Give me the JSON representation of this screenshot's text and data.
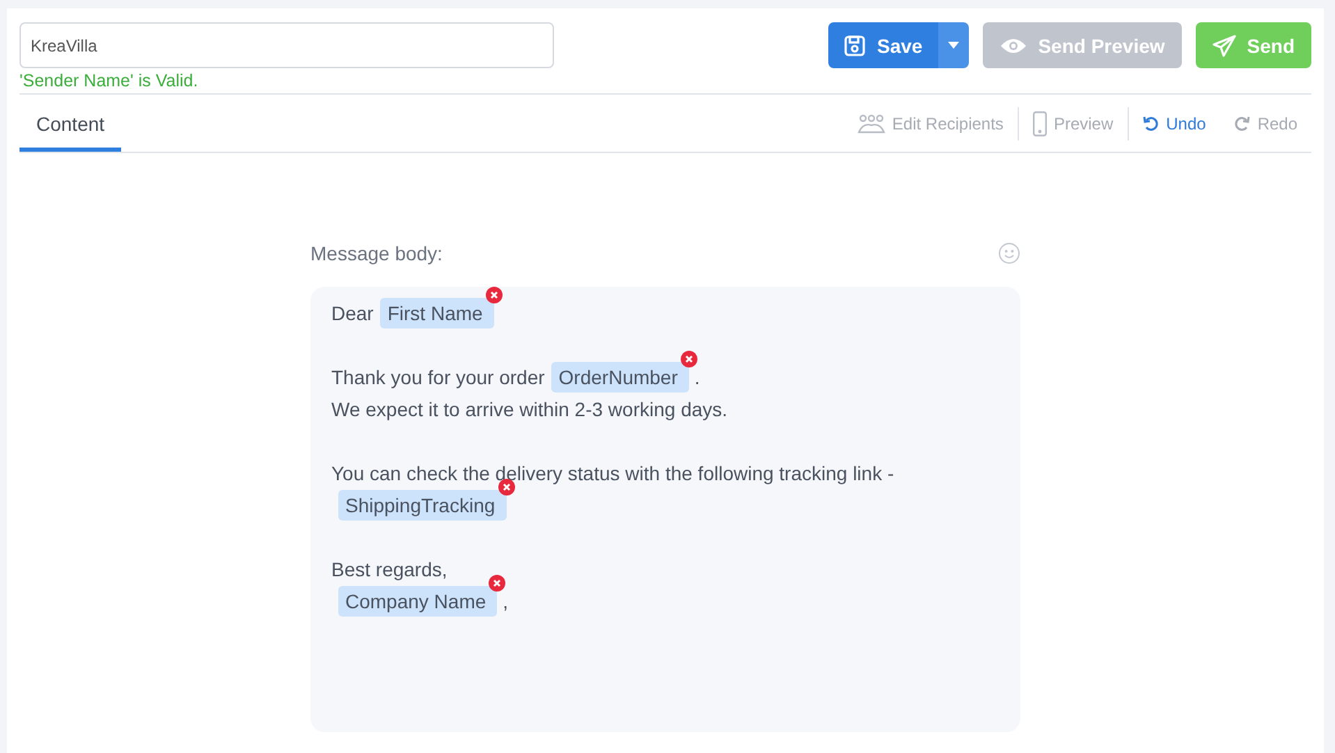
{
  "sender_field": {
    "value": "KreaVilla",
    "validation": "'Sender Name' is Valid."
  },
  "actions": [
    {
      "kind": "save",
      "label": "Save",
      "disabled": false
    },
    {
      "kind": "send_preview",
      "label": "Send Preview",
      "disabled": true
    },
    {
      "kind": "send",
      "label": "Send",
      "disabled": false
    }
  ],
  "tabs": [
    {
      "label": "Content",
      "selected": true
    }
  ],
  "toolbar": [
    {
      "kind": "recipients",
      "label": "Edit Recipients",
      "disabled": true
    },
    {
      "kind": "preview",
      "label": "Preview",
      "disabled": true
    },
    {
      "kind": "undo",
      "label": "Undo",
      "disabled": false
    },
    {
      "kind": "redo",
      "label": "Redo",
      "disabled": true
    }
  ],
  "message": {
    "label": "Message body:",
    "paragraphs": [
      [
        [
          {
            "kind": "text",
            "text": "Dear"
          },
          {
            "kind": "tag",
            "text": "First Name"
          }
        ]
      ],
      [
        [
          {
            "kind": "text",
            "text": "Thank you for your order"
          },
          {
            "kind": "tag",
            "text": "OrderNumber"
          },
          {
            "kind": "text",
            "text": "."
          }
        ],
        [
          {
            "kind": "text",
            "text": "We expect it to arrive within 2-3 working days."
          }
        ]
      ],
      [
        [
          {
            "kind": "text",
            "text": "You can check the delivery status with the following tracking link -"
          }
        ],
        [
          {
            "kind": "tag",
            "text": "ShippingTracking"
          }
        ]
      ],
      [
        [
          {
            "kind": "text",
            "text": "Best regards,"
          }
        ],
        [
          {
            "kind": "tag",
            "text": "Company Name"
          },
          {
            "kind": "text",
            "text": ","
          }
        ]
      ]
    ]
  }
}
